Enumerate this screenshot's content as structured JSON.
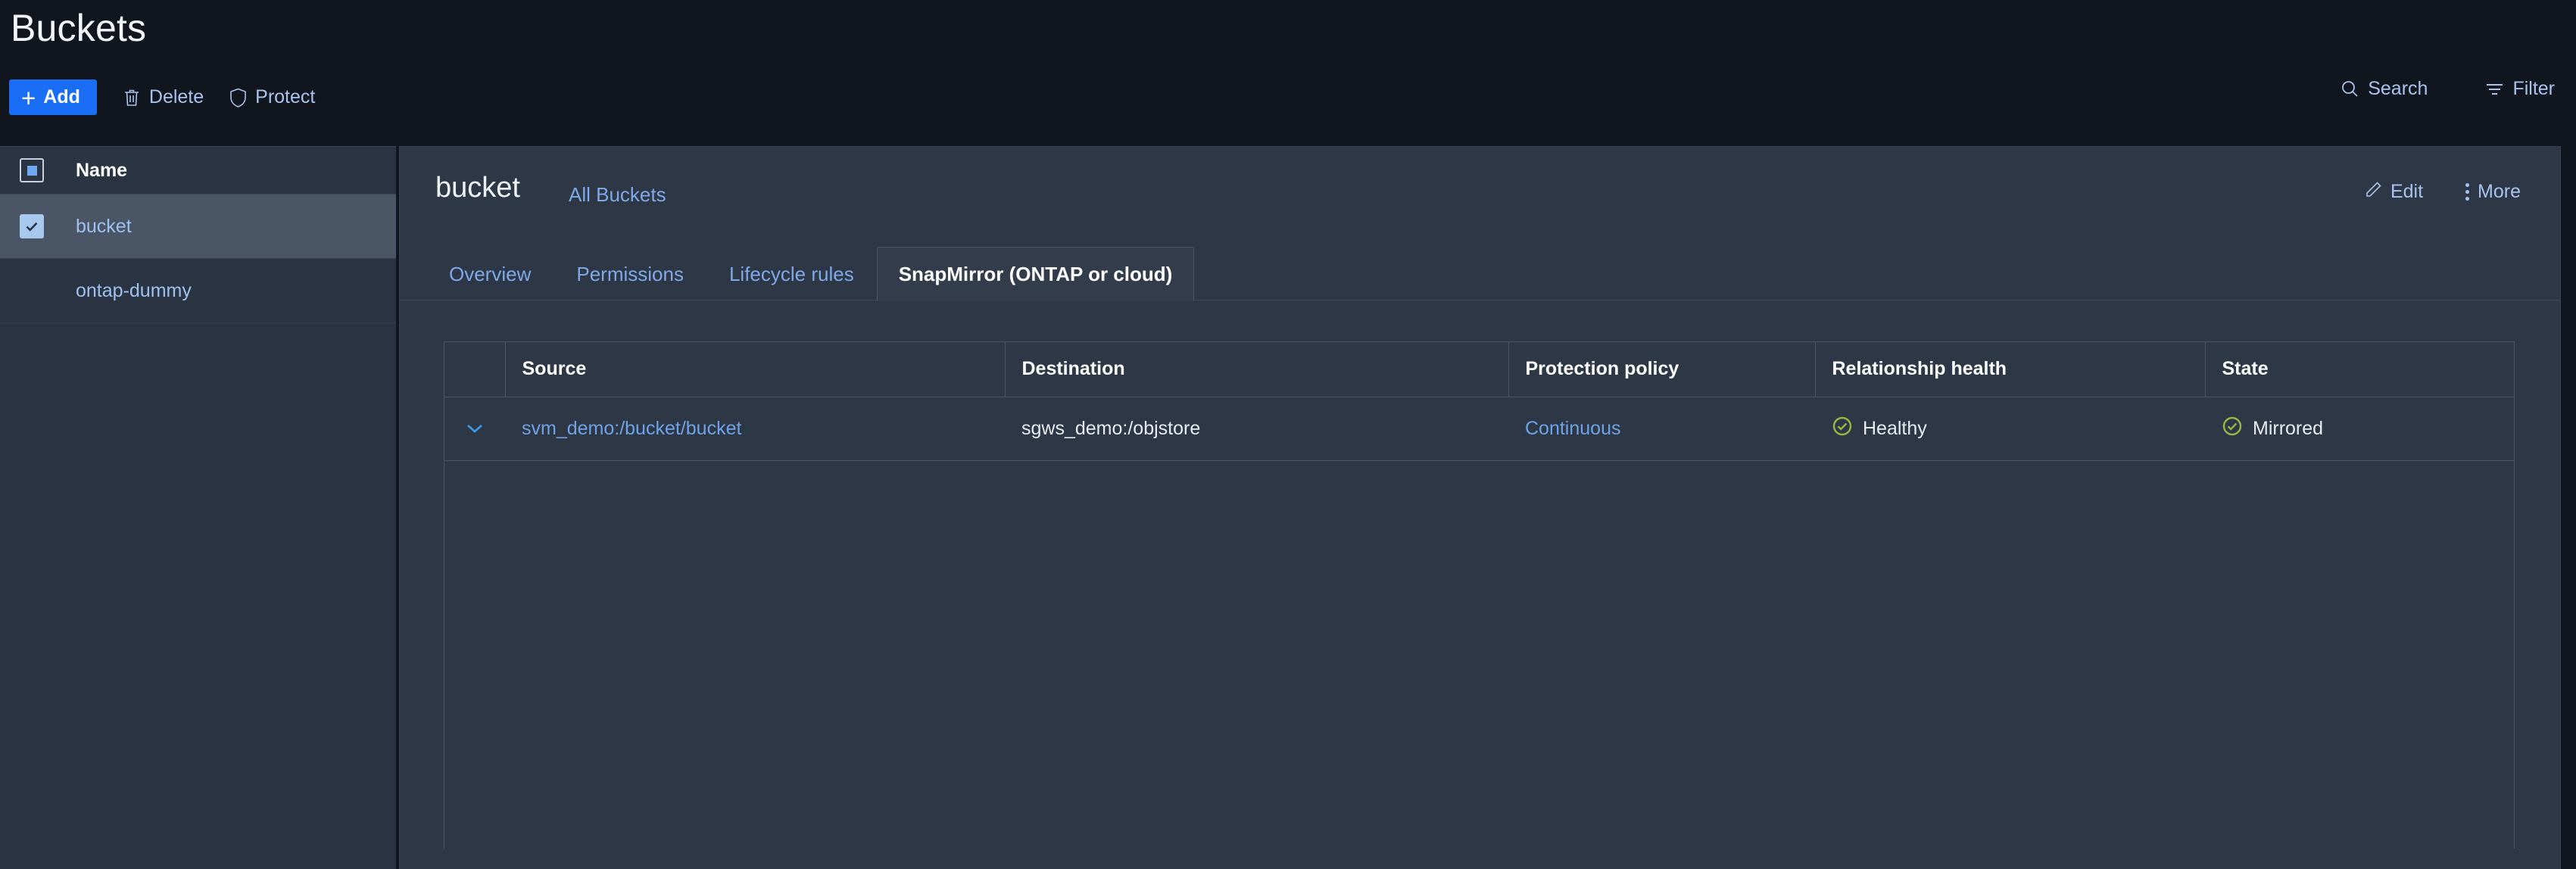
{
  "page": {
    "title": "Buckets"
  },
  "toolbar": {
    "add_label": "Add",
    "delete_label": "Delete",
    "protect_label": "Protect",
    "search_label": "Search",
    "filter_label": "Filter"
  },
  "sidebar": {
    "header": {
      "name_label": "Name"
    },
    "rows": [
      {
        "label": "bucket",
        "selected": true,
        "checked": true
      },
      {
        "label": "ontap-dummy",
        "selected": false,
        "checked": false
      }
    ]
  },
  "detail": {
    "bucket_name": "bucket",
    "all_buckets_link": "All Buckets",
    "edit_label": "Edit",
    "more_label": "More",
    "tabs": [
      {
        "label": "Overview",
        "active": false
      },
      {
        "label": "Permissions",
        "active": false
      },
      {
        "label": "Lifecycle rules",
        "active": false
      },
      {
        "label": "SnapMirror (ONTAP or cloud)",
        "active": true
      }
    ]
  },
  "table": {
    "columns": {
      "source": "Source",
      "destination": "Destination",
      "protection_policy": "Protection policy",
      "relationship_health": "Relationship health",
      "state": "State"
    },
    "rows": [
      {
        "source": "svm_demo:/bucket/bucket",
        "destination": "sgws_demo:/objstore",
        "protection_policy": "Continuous",
        "relationship_health": "Healthy",
        "state": "Mirrored"
      }
    ]
  },
  "colors": {
    "accent_blue": "#1a6ef5",
    "link_blue": "#7fa9e8",
    "status_green": "#97b845",
    "page_bg": "#10151e",
    "panel_bg": "#2e3745",
    "sidebar_bg": "#2b3442",
    "sidebar_selected": "#4a5666"
  }
}
